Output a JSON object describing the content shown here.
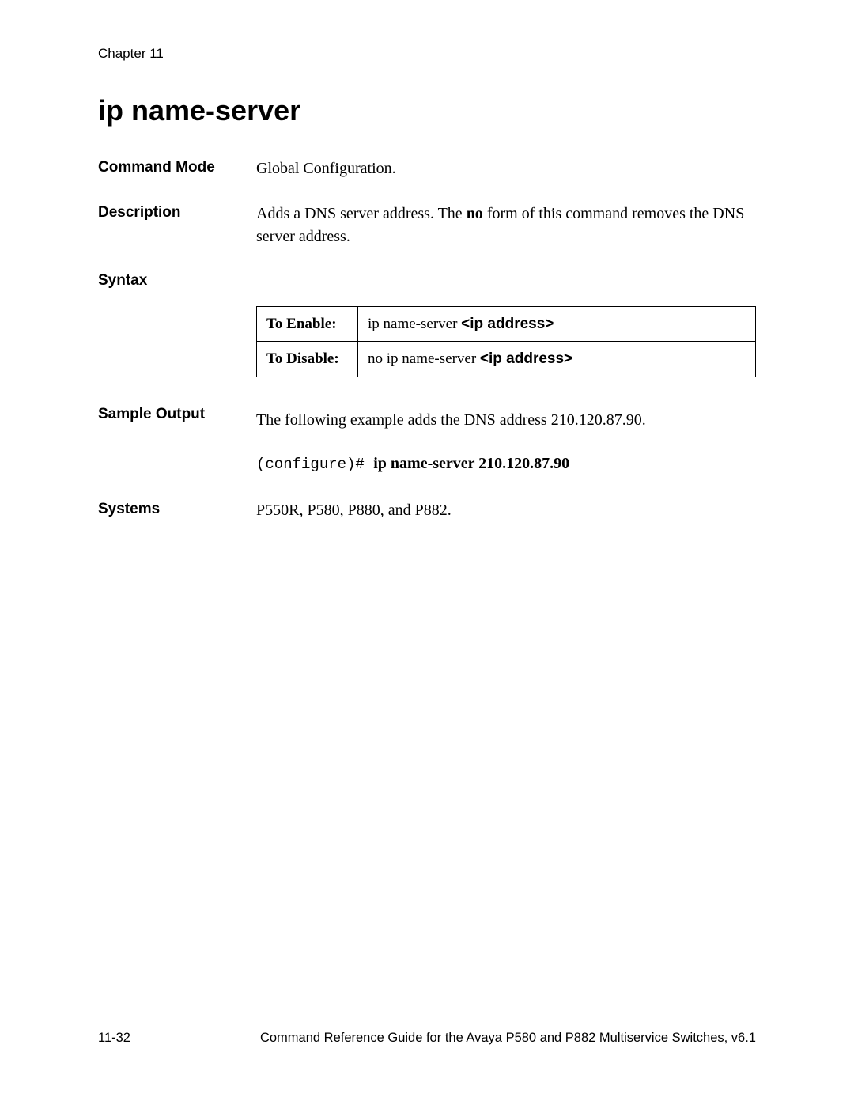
{
  "header": {
    "chapter": "Chapter 11"
  },
  "title": "ip name-server",
  "sections": {
    "command_mode": {
      "label": "Command Mode",
      "value": "Global Configuration."
    },
    "description": {
      "label": "Description",
      "prefix": "Adds a DNS server address. The ",
      "no_word": "no",
      "suffix": " form of this command removes the DNS server address."
    },
    "syntax": {
      "label": "Syntax",
      "rows": [
        {
          "head": "To Enable:",
          "cmd_prefix": "ip name-server ",
          "cmd_bold": "<ip address>"
        },
        {
          "head": "To Disable:",
          "cmd_prefix": "no ip name-server ",
          "cmd_bold": "<ip address>"
        }
      ]
    },
    "sample_output": {
      "label": "Sample Output",
      "intro": "The following example adds the DNS address 210.120.87.90.",
      "prompt": "(configure)# ",
      "command": "ip name-server 210.120.87.90"
    },
    "systems": {
      "label": "Systems",
      "value": "P550R, P580, P880, and P882."
    }
  },
  "footer": {
    "page": "11-32",
    "doc_title": "Command Reference Guide for the Avaya P580 and P882 Multiservice Switches, v6.1"
  }
}
